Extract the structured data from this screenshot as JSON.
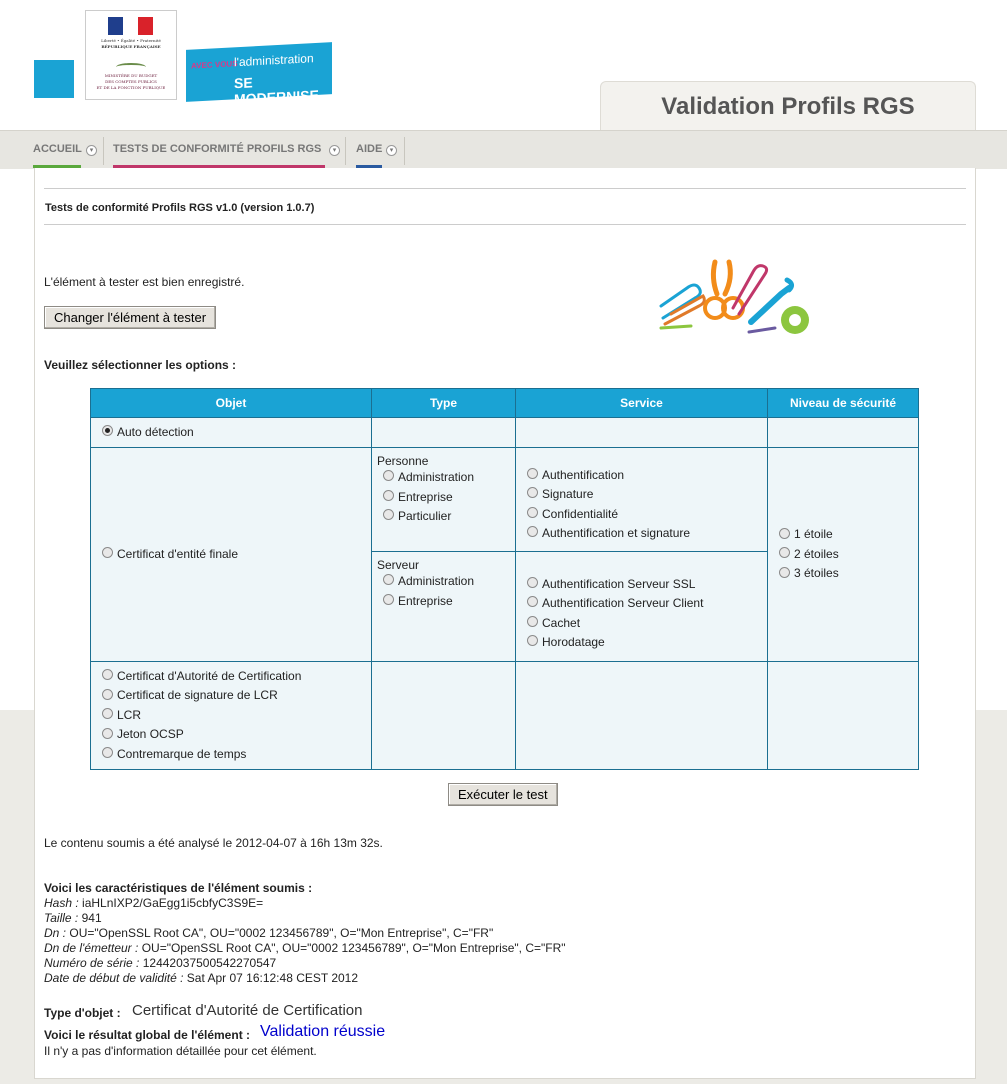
{
  "header": {
    "marianne_top": "Liberté • Égalité • Fraternité",
    "marianne_rf": "RÉPUBLIQUE FRANÇAISE",
    "ministry": [
      "MINISTÈRE DU BUDGET",
      "DES COMPTES PUBLICS",
      "ET DE LA FONCTION PUBLIQUE"
    ],
    "modernise_a": "AVEC VOUS",
    "modernise_b": "l'administration",
    "modernise_c": "SE MODERNISE",
    "app_title": "Validation Profils RGS"
  },
  "nav": {
    "items": [
      {
        "label": "ACCUEIL",
        "color": "#5aa83c"
      },
      {
        "label": "TESTS DE CONFORMITÉ PROFILS RGS",
        "color": "#c0376a"
      },
      {
        "label": "AIDE",
        "color": "#2a5aa0"
      }
    ]
  },
  "main": {
    "section_title": "Tests de conformité Profils RGS v1.0 (version 1.0.7)",
    "registered_msg": "L'élément à tester est bien enregistré.",
    "change_button": "Changer l'élément à tester",
    "select_options_label": "Veuillez sélectionner les options :",
    "table": {
      "headers": [
        "Objet",
        "Type",
        "Service",
        "Niveau de sécurité"
      ],
      "auto_detect": "Auto détection",
      "cert_entite_finale": "Certificat d'entité finale",
      "personne_label": "Personne",
      "personne_types": [
        "Administration",
        "Entreprise",
        "Particulier"
      ],
      "serveur_label": "Serveur",
      "serveur_types": [
        "Administration",
        "Entreprise"
      ],
      "personne_services": [
        "Authentification",
        "Signature",
        "Confidentialité",
        "Authentification et signature"
      ],
      "serveur_services": [
        "Authentification Serveur SSL",
        "Authentification Serveur Client",
        "Cachet",
        "Horodatage"
      ],
      "niveaux": [
        "1 étoile",
        "2 étoiles",
        "3 étoiles"
      ],
      "other_objects": [
        "Certificat d'Autorité de Certification",
        "Certificat de signature de LCR",
        "LCR",
        "Jeton OCSP",
        "Contremarque de temps"
      ]
    },
    "execute_button": "Exécuter le test",
    "analysed_msg": "Le contenu soumis a été analysé le 2012-04-07 à 16h 13m 32s.",
    "characteristics_title": "Voici les caractéristiques de l'élément soumis :",
    "characteristics": [
      {
        "label": "Hash",
        "value": "iaHLnIXP2/GaEgg1i5cbfyC3S9E="
      },
      {
        "label": "Taille",
        "value": "941"
      },
      {
        "label": "Dn",
        "value": "OU=\"OpenSSL Root CA\", OU=\"0002 123456789\", O=\"Mon Entreprise\", C=\"FR\""
      },
      {
        "label": "Dn de l'émetteur",
        "value": "OU=\"OpenSSL Root CA\", OU=\"0002 123456789\", O=\"Mon Entreprise\", C=\"FR\""
      },
      {
        "label": "Numéro de série",
        "value": "12442037500542270547"
      },
      {
        "label": "Date de début de validité",
        "value": "Sat Apr 07 16:12:48 CEST 2012"
      }
    ],
    "object_type_label": "Type d'objet :",
    "object_type_value": "Certificat d'Autorité de Certification",
    "global_result_label": "Voici le résultat global de l'élément :",
    "global_result_value": "Validation réussie",
    "no_detail_msg": "Il n'y a pas d'information détaillée pour cet élément."
  }
}
